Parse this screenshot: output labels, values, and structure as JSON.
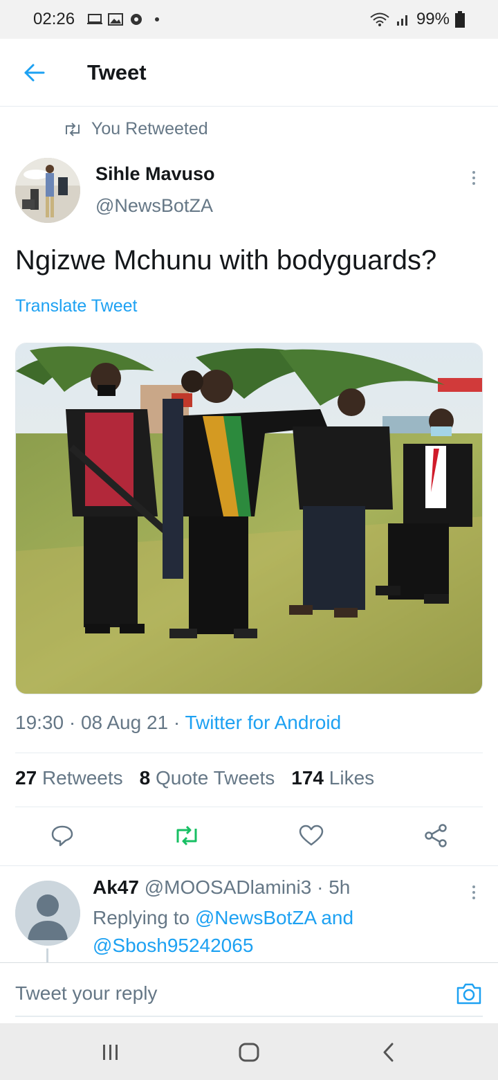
{
  "status_bar": {
    "time": "02:26",
    "battery": "99%"
  },
  "header": {
    "title": "Tweet"
  },
  "retweet_context": {
    "label": "You Retweeted"
  },
  "tweet": {
    "author_name": "Sihle Mavuso",
    "author_handle": "@NewsBotZA",
    "text": "Ngizwe Mchunu with bodyguards?",
    "translate_label": "Translate Tweet",
    "time": "19:30",
    "date": "08 Aug 21",
    "source": "Twitter for Android",
    "stats": {
      "retweets_count": "27",
      "retweets_label": "Retweets",
      "quotes_count": "8",
      "quotes_label": "Quote Tweets",
      "likes_count": "174",
      "likes_label": "Likes"
    }
  },
  "actions": {
    "reply_icon": "reply-icon",
    "retweet_icon": "retweet-icon",
    "like_icon": "heart-icon",
    "share_icon": "share-icon",
    "retweet_active_color": "#17bf63"
  },
  "reply": {
    "name": "Ak47",
    "handle": "@MOOSADlamini3",
    "age": "5h",
    "replying_prefix": "Replying to",
    "mention_1": "@NewsBotZA",
    "joiner": "and",
    "mention_2": "@Sbosh95242065"
  },
  "compose": {
    "placeholder": "Tweet your reply"
  },
  "colors": {
    "accent": "#1da1f2",
    "muted": "#657786",
    "text": "#14171a"
  }
}
